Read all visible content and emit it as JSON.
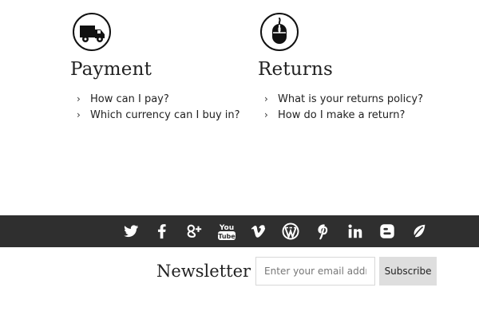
{
  "help": {
    "payment": {
      "title": "Payment",
      "icon": "delivery-truck-icon",
      "items": [
        "How can I pay?",
        "Which currency can I buy in?"
      ]
    },
    "returns": {
      "title": "Returns",
      "icon": "computer-mouse-icon",
      "items": [
        "What is your returns policy?",
        "How do I make a return?"
      ]
    }
  },
  "social": {
    "background": "#2f2f2f",
    "icons": [
      "twitter-icon",
      "facebook-icon",
      "google-plus-icon",
      "youtube-icon",
      "vimeo-icon",
      "wordpress-icon",
      "pinterest-icon",
      "linkedin-icon",
      "blogger-icon",
      "leaf-icon"
    ],
    "youtube_label_top": "You",
    "youtube_label_bottom": "Tube"
  },
  "newsletter": {
    "title": "Newsletter",
    "placeholder": "Enter your email addr ...",
    "button_label": "Subscribe"
  }
}
